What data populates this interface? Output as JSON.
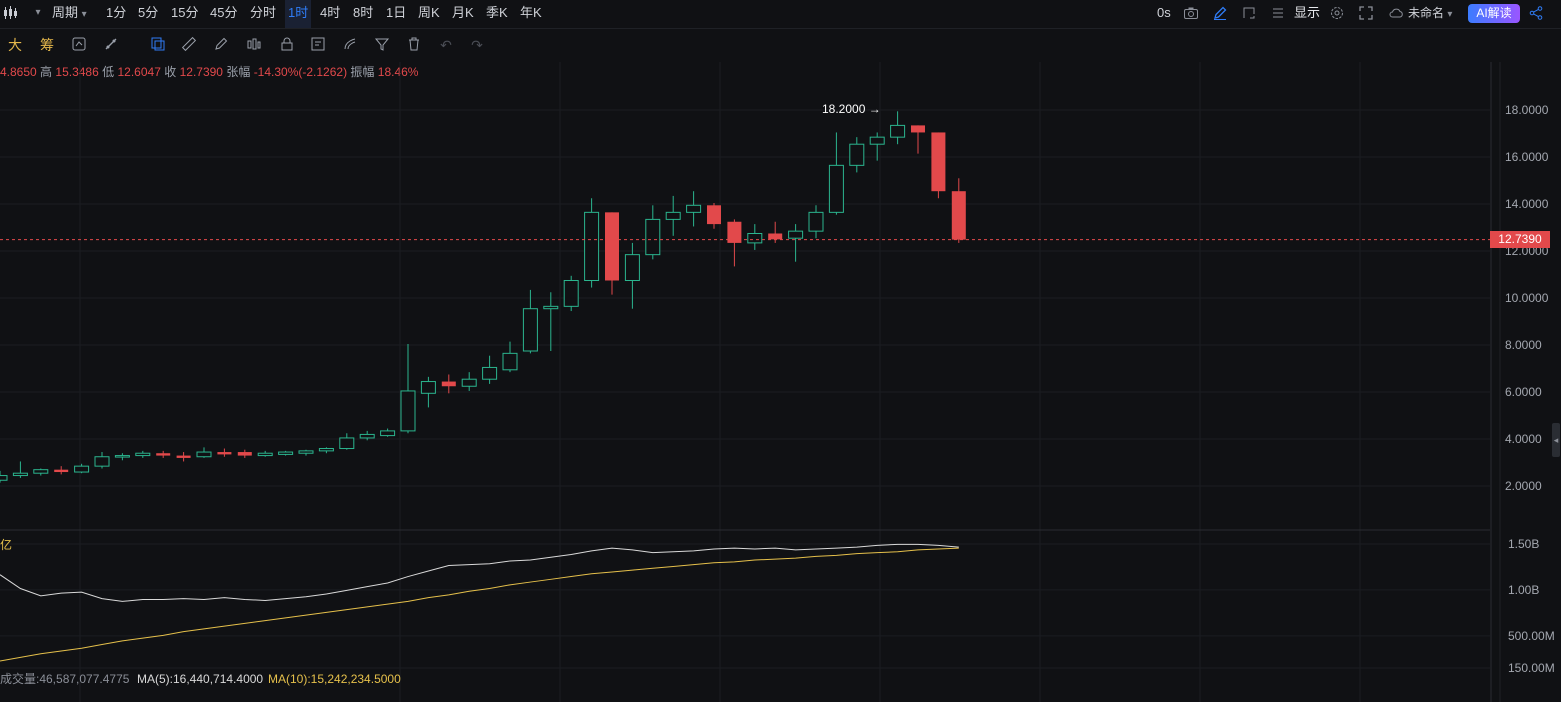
{
  "topbar": {
    "chart_type_icon": "candlestick-icon",
    "period_label": "周期",
    "intervals": [
      "1分",
      "5分",
      "15分",
      "45分",
      "分时",
      "1时",
      "4时",
      "8时",
      "1日",
      "周K",
      "月K",
      "季K",
      "年K"
    ],
    "active_interval": "1时",
    "countdown": "0s",
    "display_label": "显示",
    "workspace_name": "未命名",
    "ai_button": "AI解读"
  },
  "drawing_toolbar": {
    "big_label": "大",
    "chip_label": "筹"
  },
  "ohlc": {
    "open_value": "4.8650",
    "high_label": "高",
    "high_value": "15.3486",
    "low_label": "低",
    "low_value": "12.6047",
    "close_label": "收",
    "close_value": "12.7390",
    "change_label": "张幅",
    "change_value": "-14.30%(-2.1262)",
    "amplitude_label": "振幅",
    "amplitude_value": "18.46%"
  },
  "price_axis": {
    "ticks": [
      "18.0000",
      "16.0000",
      "14.0000",
      "12.0000",
      "10.0000",
      "8.0000",
      "6.0000",
      "4.0000",
      "2.0000"
    ],
    "current_price": "12.7390",
    "high_marker": "18.2000 →"
  },
  "volume_axis": {
    "ticks": [
      "1.50B",
      "1.00B",
      "500.00M",
      "150.00M"
    ],
    "unit_label": "亿"
  },
  "volume_info": {
    "volume_text": "成交量:46,587,077.4775",
    "ma5_text": "MA(5):16,440,714.4000",
    "ma10_text": "MA(10):15,242,234.5000"
  },
  "colors": {
    "up": "#2bb58e",
    "down": "#e2494b",
    "ma5": "#d9d9d9",
    "ma10": "#e5c04b",
    "accent": "#2f7cf6"
  },
  "chart_data": {
    "type": "candlestick",
    "ylim": [
      0.9,
      19.1
    ],
    "candles": [
      {
        "o": 2.5,
        "h": 2.9,
        "l": 2.4,
        "c": 2.7
      },
      {
        "o": 2.7,
        "h": 3.3,
        "l": 2.6,
        "c": 2.8
      },
      {
        "o": 2.8,
        "h": 3.0,
        "l": 2.7,
        "c": 2.95
      },
      {
        "o": 2.95,
        "h": 3.1,
        "l": 2.75,
        "c": 2.85
      },
      {
        "o": 2.85,
        "h": 3.2,
        "l": 2.8,
        "c": 3.1
      },
      {
        "o": 3.1,
        "h": 3.7,
        "l": 3.0,
        "c": 3.5
      },
      {
        "o": 3.5,
        "h": 3.65,
        "l": 3.35,
        "c": 3.55
      },
      {
        "o": 3.55,
        "h": 3.75,
        "l": 3.45,
        "c": 3.65
      },
      {
        "o": 3.65,
        "h": 3.75,
        "l": 3.45,
        "c": 3.55
      },
      {
        "o": 3.55,
        "h": 3.7,
        "l": 3.3,
        "c": 3.45
      },
      {
        "o": 3.5,
        "h": 3.9,
        "l": 3.45,
        "c": 3.7
      },
      {
        "o": 3.7,
        "h": 3.85,
        "l": 3.5,
        "c": 3.6
      },
      {
        "o": 3.7,
        "h": 3.8,
        "l": 3.45,
        "c": 3.55
      },
      {
        "o": 3.55,
        "h": 3.75,
        "l": 3.5,
        "c": 3.65
      },
      {
        "o": 3.6,
        "h": 3.75,
        "l": 3.55,
        "c": 3.7
      },
      {
        "o": 3.65,
        "h": 3.8,
        "l": 3.55,
        "c": 3.75
      },
      {
        "o": 3.75,
        "h": 3.9,
        "l": 3.65,
        "c": 3.85
      },
      {
        "o": 3.85,
        "h": 4.5,
        "l": 3.8,
        "c": 4.3
      },
      {
        "o": 4.3,
        "h": 4.6,
        "l": 4.2,
        "c": 4.45
      },
      {
        "o": 4.4,
        "h": 4.7,
        "l": 4.35,
        "c": 4.6
      },
      {
        "o": 4.6,
        "h": 8.3,
        "l": 4.5,
        "c": 6.3
      },
      {
        "o": 6.2,
        "h": 6.9,
        "l": 5.6,
        "c": 6.7
      },
      {
        "o": 6.7,
        "h": 7.0,
        "l": 6.2,
        "c": 6.5
      },
      {
        "o": 6.5,
        "h": 7.1,
        "l": 6.3,
        "c": 6.8
      },
      {
        "o": 6.8,
        "h": 7.8,
        "l": 6.6,
        "c": 7.3
      },
      {
        "o": 7.2,
        "h": 8.4,
        "l": 7.1,
        "c": 7.9
      },
      {
        "o": 8.0,
        "h": 10.6,
        "l": 7.9,
        "c": 9.8
      },
      {
        "o": 9.8,
        "h": 10.5,
        "l": 8.0,
        "c": 9.9
      },
      {
        "o": 9.9,
        "h": 11.2,
        "l": 9.7,
        "c": 11.0
      },
      {
        "o": 11.0,
        "h": 14.5,
        "l": 10.7,
        "c": 13.9
      },
      {
        "o": 13.9,
        "h": 13.9,
        "l": 10.4,
        "c": 11.0
      },
      {
        "o": 11.0,
        "h": 12.6,
        "l": 9.8,
        "c": 12.1
      },
      {
        "o": 12.1,
        "h": 14.2,
        "l": 11.9,
        "c": 13.6
      },
      {
        "o": 13.6,
        "h": 14.6,
        "l": 12.9,
        "c": 13.9
      },
      {
        "o": 13.9,
        "h": 14.8,
        "l": 13.3,
        "c": 14.2
      },
      {
        "o": 14.2,
        "h": 14.3,
        "l": 13.2,
        "c": 13.4
      },
      {
        "o": 13.5,
        "h": 13.6,
        "l": 11.6,
        "c": 12.6
      },
      {
        "o": 12.6,
        "h": 13.4,
        "l": 12.3,
        "c": 13.0
      },
      {
        "o": 13.0,
        "h": 13.5,
        "l": 12.6,
        "c": 12.75
      },
      {
        "o": 12.8,
        "h": 13.4,
        "l": 11.8,
        "c": 13.1
      },
      {
        "o": 13.1,
        "h": 14.2,
        "l": 12.8,
        "c": 13.9
      },
      {
        "o": 13.9,
        "h": 17.3,
        "l": 13.8,
        "c": 15.9
      },
      {
        "o": 15.9,
        "h": 17.1,
        "l": 15.6,
        "c": 16.8
      },
      {
        "o": 16.8,
        "h": 17.3,
        "l": 16.1,
        "c": 17.1
      },
      {
        "o": 17.1,
        "h": 18.2,
        "l": 16.8,
        "c": 17.6
      },
      {
        "o": 17.6,
        "h": 17.6,
        "l": 16.4,
        "c": 17.3
      },
      {
        "o": 17.3,
        "h": 17.3,
        "l": 14.5,
        "c": 14.8
      },
      {
        "o": 14.8,
        "h": 15.35,
        "l": 12.6,
        "c": 12.74
      }
    ],
    "ma5": [
      1.22,
      1.07,
      0.99,
      1.02,
      1.03,
      0.96,
      0.93,
      0.95,
      0.95,
      0.96,
      0.95,
      0.97,
      0.95,
      0.94,
      0.96,
      0.98,
      1.01,
      1.05,
      1.09,
      1.13,
      1.2,
      1.26,
      1.32,
      1.33,
      1.34,
      1.37,
      1.38,
      1.41,
      1.44,
      1.48,
      1.51,
      1.49,
      1.46,
      1.47,
      1.48,
      1.5,
      1.51,
      1.5,
      1.51,
      1.49,
      1.5,
      1.51,
      1.52,
      1.54,
      1.55,
      1.55,
      1.54,
      1.52
    ],
    "ma10": [
      0.28,
      0.32,
      0.36,
      0.39,
      0.42,
      0.46,
      0.5,
      0.53,
      0.56,
      0.6,
      0.63,
      0.66,
      0.69,
      0.72,
      0.75,
      0.78,
      0.81,
      0.84,
      0.87,
      0.9,
      0.93,
      0.97,
      1.0,
      1.04,
      1.07,
      1.11,
      1.14,
      1.17,
      1.2,
      1.23,
      1.25,
      1.27,
      1.29,
      1.31,
      1.33,
      1.35,
      1.36,
      1.38,
      1.39,
      1.4,
      1.42,
      1.43,
      1.45,
      1.46,
      1.47,
      1.49,
      1.5,
      1.51
    ]
  }
}
